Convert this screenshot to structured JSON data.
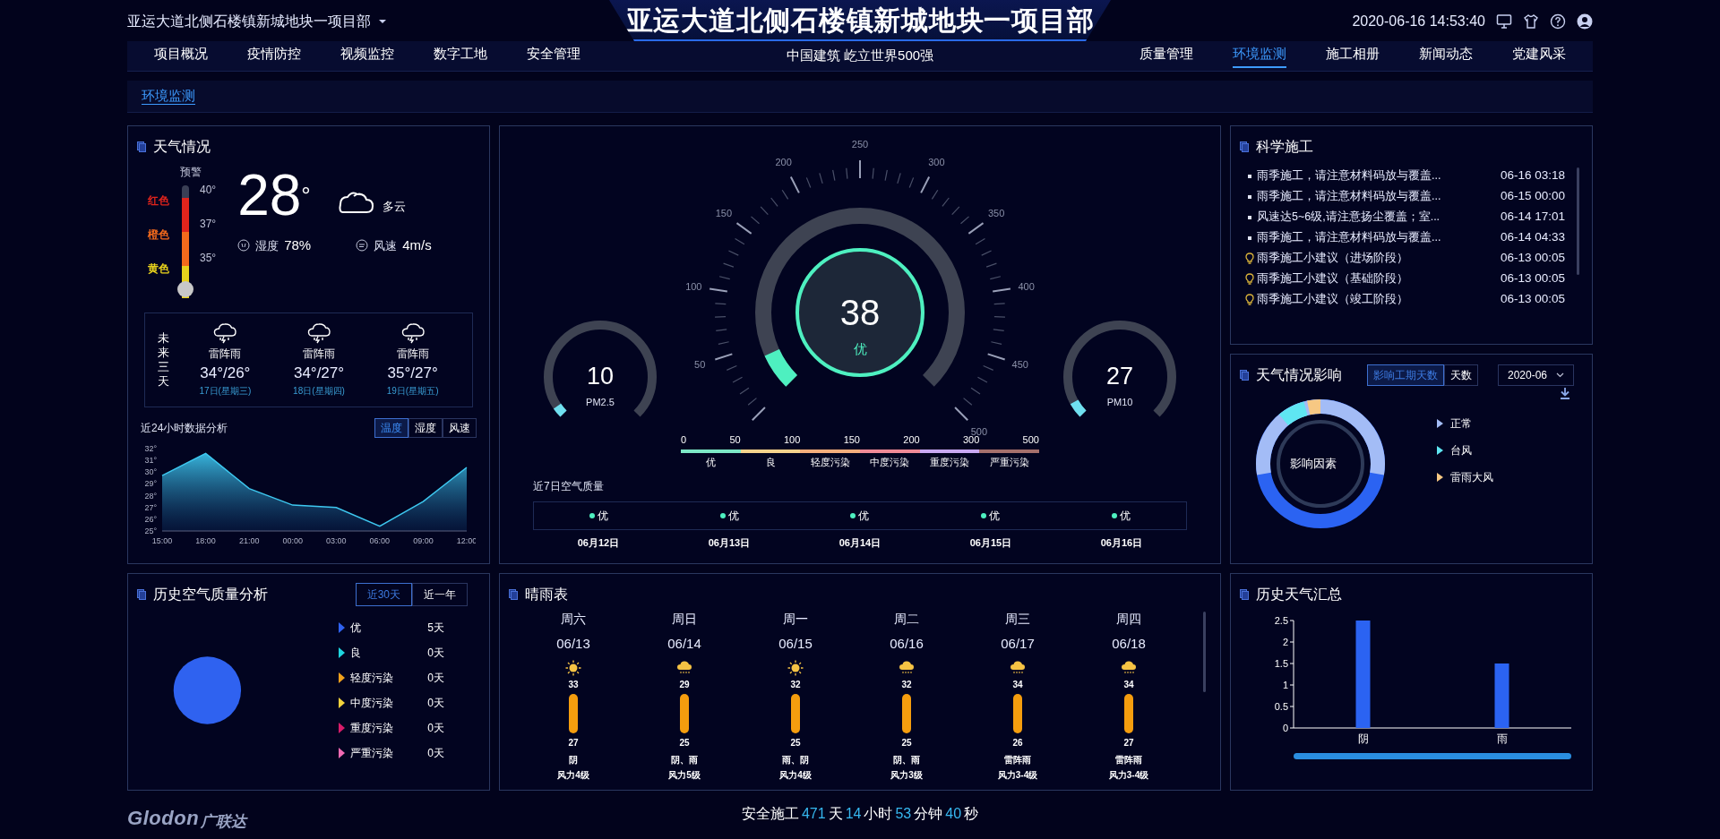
{
  "header": {
    "project_select": "亚运大道北侧石楼镇新城地块一项目部",
    "title": "亚运大道北侧石楼镇新城地块一项目部",
    "subtitle": "中国建筑 屹立世界500强",
    "datetime": "2020-06-16 14:53:40"
  },
  "nav_left": [
    {
      "label": "项目概况",
      "selected": false
    },
    {
      "label": "疫情防控",
      "selected": false
    },
    {
      "label": "视频监控",
      "selected": false
    },
    {
      "label": "数字工地",
      "selected": false
    },
    {
      "label": "安全管理",
      "selected": false
    }
  ],
  "nav_right": [
    {
      "label": "质量管理",
      "selected": false
    },
    {
      "label": "环境监测",
      "selected": true
    },
    {
      "label": "施工相册",
      "selected": false
    },
    {
      "label": "新闻动态",
      "selected": false
    },
    {
      "label": "党建风采",
      "selected": false
    }
  ],
  "breadcrumb": "环境监测",
  "weather": {
    "title": "天气情况",
    "warning_label": "预警",
    "alert_levels": [
      {
        "label": "红色",
        "temp": "40°",
        "color": "#e0241c"
      },
      {
        "label": "橙色",
        "temp": "37°",
        "color": "#f36a1c"
      },
      {
        "label": "黄色",
        "temp": "35°",
        "color": "#e8d21c"
      }
    ],
    "temperature": "28$^{°}$",
    "condition": "多云",
    "humidity_label": "湿度",
    "humidity": "78%",
    "wind_label": "风速",
    "wind": "4m/s",
    "forecast_label": "未来三天",
    "forecast": [
      {
        "condition": "雷阵雨",
        "temps": "34°/26°",
        "date": "17日(星期三)"
      },
      {
        "condition": "雷阵雨",
        "temps": "34°/27°",
        "date": "18日(星期四)"
      },
      {
        "condition": "雷阵雨",
        "temps": "35°/27°",
        "date": "19日(星期五)"
      }
    ],
    "chart_title": "近24小时数据分析",
    "chart_tabs": [
      {
        "label": "温度",
        "selected": true
      },
      {
        "label": "湿度",
        "selected": false
      },
      {
        "label": "风速",
        "selected": false
      }
    ],
    "chart_data": {
      "type": "area",
      "categories": [
        "15:00",
        "18:00",
        "21:00",
        "00:00",
        "03:00",
        "06:00",
        "09:00",
        "12:00"
      ],
      "series": [
        {
          "color": "#3ec8f0",
          "values": [
            29.7,
            31.6,
            28.6,
            27.2,
            27,
            25.4,
            27.5,
            30.4
          ]
        }
      ],
      "ylim": [
        25,
        32
      ],
      "yticks": [
        {
          "value": 25,
          "label": "25°"
        },
        {
          "value": 26,
          "label": "26°"
        },
        {
          "value": 27,
          "label": "27°"
        },
        {
          "value": 28,
          "label": "28°"
        },
        {
          "value": 29,
          "label": "29°"
        },
        {
          "value": 30,
          "label": "30°"
        },
        {
          "value": 31,
          "label": "31°"
        },
        {
          "value": 32,
          "label": "32°"
        }
      ]
    }
  },
  "air": {
    "main": {
      "value": "38",
      "grade": "优",
      "level": 0.076,
      "scale": [
        "50",
        "100",
        "150",
        "200",
        "250",
        "300",
        "350",
        "400",
        "450",
        "500"
      ]
    },
    "small": [
      {
        "value": "10",
        "label": "PM2.5",
        "level": 0.04
      },
      {
        "value": "27",
        "label": "PM10",
        "level": 0.06
      }
    ],
    "scale_ticks": [
      "0",
      "50",
      "100",
      "150",
      "200",
      "300",
      "500"
    ],
    "grades": [
      {
        "label": "优",
        "color": "#7de8c6"
      },
      {
        "label": "良",
        "color": "#f6d38c"
      },
      {
        "label": "轻度污染",
        "color": "#f5ae7c"
      },
      {
        "label": "中度污染",
        "color": "#f08a96"
      },
      {
        "label": "重度污染",
        "color": "#c9a9f2"
      },
      {
        "label": "严重污染",
        "color": "#a5706c"
      }
    ],
    "week_title": "近7日空气质量",
    "week": [
      {
        "grade": "优",
        "date": "06月12日"
      },
      {
        "grade": "优",
        "date": "06月13日"
      },
      {
        "grade": "优",
        "date": "06月14日"
      },
      {
        "grade": "优",
        "date": "06月15日"
      },
      {
        "grade": "优",
        "date": "06月16日"
      }
    ]
  },
  "science": {
    "title": "科学施工",
    "items": [
      {
        "kind": "notice",
        "text": "雨季施工，请注意材料码放与覆盖...",
        "time": "06-16 03:18"
      },
      {
        "kind": "notice",
        "text": "雨季施工，请注意材料码放与覆盖...",
        "time": "06-15 00:00"
      },
      {
        "kind": "notice",
        "text": "风速达5~6级,请注意扬尘覆盖；室...",
        "time": "06-14 17:01"
      },
      {
        "kind": "notice",
        "text": "雨季施工，请注意材料码放与覆盖...",
        "time": "06-14 04:33"
      },
      {
        "kind": "tip",
        "text": "雨季施工小建议（进场阶段）",
        "time": "06-13 00:05"
      },
      {
        "kind": "tip",
        "text": "雨季施工小建议（基础阶段）",
        "time": "06-13 00:05"
      },
      {
        "kind": "tip",
        "text": "雨季施工小建议（竣工阶段）",
        "time": "06-13 00:05"
      }
    ]
  },
  "impact": {
    "title": "天气情况影响",
    "toggle": [
      {
        "label": "影响工期天数",
        "selected": true
      },
      {
        "label": "天数",
        "selected": false
      }
    ],
    "month": "2020-06",
    "center": "影响因素",
    "legend": [
      {
        "label": "正常",
        "color": "#a3bcf6"
      },
      {
        "label": "台风",
        "color": "#5fe6f2"
      },
      {
        "label": "雷雨大风",
        "color": "#f7c883"
      }
    ]
  },
  "history_air": {
    "title": "历史空气质量分析",
    "tabs": [
      {
        "label": "近30天",
        "selected": true
      },
      {
        "label": "近一年",
        "selected": false
      }
    ],
    "legend": [
      {
        "label": "优",
        "days": "5天",
        "color": "#2f62f0"
      },
      {
        "label": "良",
        "days": "0天",
        "color": "#1fd6e0"
      },
      {
        "label": "轻度污染",
        "days": "0天",
        "color": "#f0a21c"
      },
      {
        "label": "中度污染",
        "days": "0天",
        "color": "#f2d23c"
      },
      {
        "label": "重度污染",
        "days": "0天",
        "color": "#d81c6a"
      },
      {
        "label": "严重污染",
        "days": "0天",
        "color": "#f06ab4"
      }
    ]
  },
  "forecast7": {
    "title": "晴雨表",
    "days": [
      {
        "weekday": "周六",
        "date": "06/13",
        "kind": "sun",
        "high": "33",
        "low": "27",
        "condition": "阴",
        "wind": "风力4级"
      },
      {
        "weekday": "周日",
        "date": "06/14",
        "kind": "rain",
        "high": "29",
        "low": "25",
        "condition": "阴、雨",
        "wind": "风力5级"
      },
      {
        "weekday": "周一",
        "date": "06/15",
        "kind": "sun",
        "high": "32",
        "low": "25",
        "condition": "雨、阴",
        "wind": "风力4级"
      },
      {
        "weekday": "周二",
        "date": "06/16",
        "kind": "rain",
        "high": "32",
        "low": "25",
        "condition": "阴、雨",
        "wind": "风力3级"
      },
      {
        "weekday": "周三",
        "date": "06/17",
        "kind": "rain",
        "high": "34",
        "low": "26",
        "condition": "雷阵雨",
        "wind": "风力3-4级"
      },
      {
        "weekday": "周四",
        "date": "06/18",
        "kind": "rain",
        "high": "34",
        "low": "27",
        "condition": "雷阵雨",
        "wind": "风力3-4级"
      }
    ]
  },
  "history_weather": {
    "title": "历史天气汇总",
    "chart_data": {
      "type": "bar",
      "categories": [
        "阴",
        "雨"
      ],
      "series": [
        {
          "color": "#2b63f2",
          "values": [
            2.5,
            1.5
          ]
        }
      ],
      "ylim": [
        0,
        2.5
      ],
      "yticks": [
        0,
        0.5,
        1,
        1.5,
        2,
        2.5
      ]
    }
  },
  "footer": {
    "logo": "Glodon",
    "logo_cn": "广联达",
    "safety": [
      {
        "kind": "label",
        "text": "安全施工"
      },
      {
        "kind": "number",
        "text": "471"
      },
      {
        "kind": "label",
        "text": "天"
      },
      {
        "kind": "number",
        "text": "14"
      },
      {
        "kind": "label",
        "text": "小时"
      },
      {
        "kind": "number",
        "text": "53"
      },
      {
        "kind": "label",
        "text": "分钟"
      },
      {
        "kind": "number",
        "text": "40"
      },
      {
        "kind": "label",
        "text": "秒"
      }
    ]
  }
}
